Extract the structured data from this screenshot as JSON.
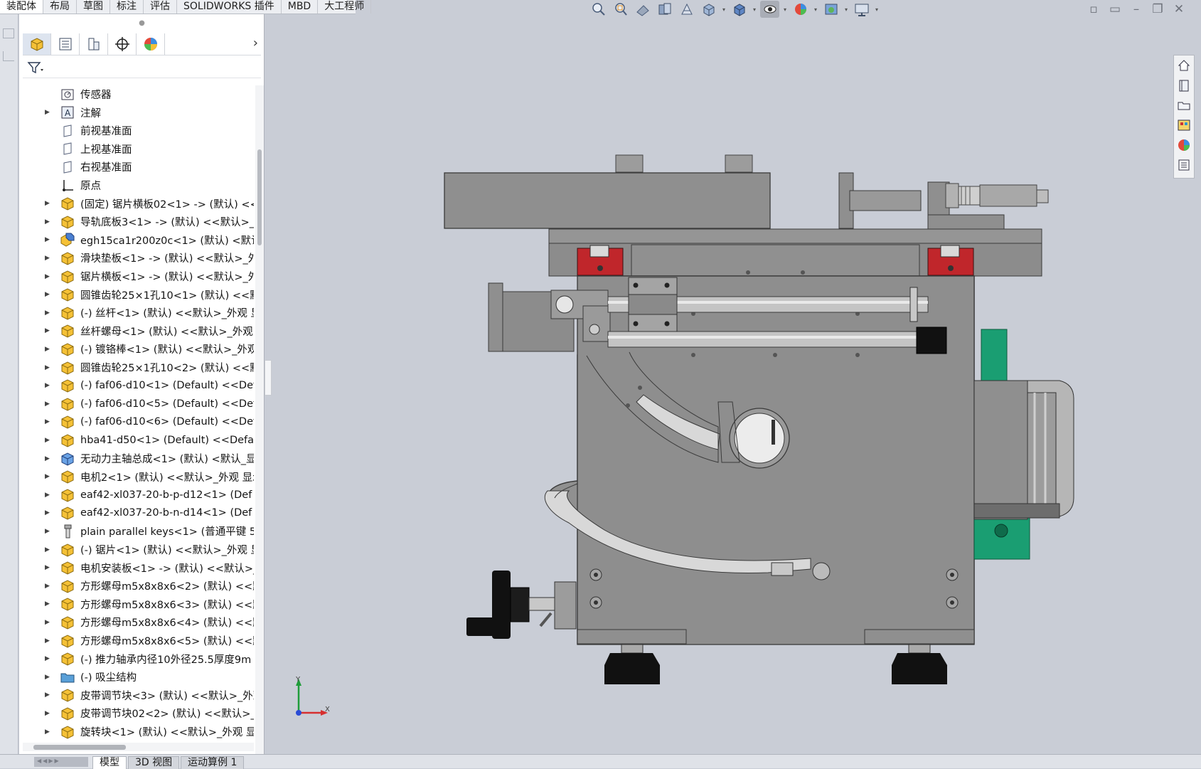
{
  "top_tabs": [
    "装配体",
    "布局",
    "草图",
    "标注",
    "评估",
    "SOLIDWORKS 插件",
    "MBD",
    "大工程师"
  ],
  "top_tabs_active": 0,
  "heads_up_toolbar": [
    "zoom-to-fit-icon",
    "zoom-to-area-icon",
    "previous-view-icon",
    "section-view-icon",
    "dynamic-annotation-icon",
    "view-orientation-icon",
    "display-style-icon",
    "hide-show-items-icon",
    "edit-appearance-icon",
    "apply-scene-icon",
    "view-settings-icon"
  ],
  "feature_manager": {
    "tool_icons": [
      "featuremanager-tree-icon",
      "property-manager-icon",
      "configuration-manager-icon",
      "dimxpert-icon",
      "display-manager-icon"
    ],
    "filter_icon": "filter-icon",
    "tree": [
      {
        "label": "传感器",
        "icon": "sensor-icon",
        "arrow": false
      },
      {
        "label": "注解",
        "icon": "annotation-icon",
        "arrow": true
      },
      {
        "label": "前视基准面",
        "icon": "plane-icon",
        "arrow": false
      },
      {
        "label": "上视基准面",
        "icon": "plane-icon",
        "arrow": false
      },
      {
        "label": "右视基准面",
        "icon": "plane-icon",
        "arrow": false
      },
      {
        "label": "原点",
        "icon": "origin-icon",
        "arrow": false
      },
      {
        "label": "(固定) 锯片横板02<1> -> (默认) <<",
        "icon": "part-icon",
        "arrow": true
      },
      {
        "label": "导轨底板3<1> -> (默认) <<默认>_外",
        "icon": "part-icon",
        "arrow": true
      },
      {
        "label": "egh15ca1r200z0c<1> (默认) <默认",
        "icon": "subassembly-icon",
        "arrow": true
      },
      {
        "label": "滑块垫板<1> -> (默认) <<默认>_外",
        "icon": "part-icon",
        "arrow": true
      },
      {
        "label": "锯片横板<1> -> (默认) <<默认>_外",
        "icon": "part-icon",
        "arrow": true
      },
      {
        "label": "圆锥齿轮25×1孔10<1> (默认) <<默",
        "icon": "part-icon",
        "arrow": true
      },
      {
        "label": "(-) 丝杆<1> (默认) <<默认>_外观 显",
        "icon": "part-icon",
        "arrow": true
      },
      {
        "label": "丝杆螺母<1> (默认) <<默认>_外观 显",
        "icon": "part-icon",
        "arrow": true
      },
      {
        "label": "(-) 镀铬棒<1> (默认) <<默认>_外观",
        "icon": "part-icon",
        "arrow": true
      },
      {
        "label": "圆锥齿轮25×1孔10<2> (默认) <<默",
        "icon": "part-icon",
        "arrow": true
      },
      {
        "label": "(-) faf06-d10<1> (Default) <<Defa",
        "icon": "part-icon",
        "arrow": true
      },
      {
        "label": "(-) faf06-d10<5> (Default) <<Defa",
        "icon": "part-icon",
        "arrow": true
      },
      {
        "label": "(-) faf06-d10<6> (Default) <<Defa",
        "icon": "part-icon",
        "arrow": true
      },
      {
        "label": "hba41-d50<1> (Default) <<Defau",
        "icon": "part-icon",
        "arrow": true
      },
      {
        "label": "无动力主轴总成<1> (默认) <默认_显",
        "icon": "subassembly-blue-icon",
        "arrow": true
      },
      {
        "label": "电机2<1> (默认) <<默认>_外观 显示",
        "icon": "part-icon",
        "arrow": true
      },
      {
        "label": "eaf42-xl037-20-b-p-d12<1> (Def",
        "icon": "part-icon",
        "arrow": true
      },
      {
        "label": "eaf42-xl037-20-b-n-d14<1> (Def",
        "icon": "part-icon",
        "arrow": true
      },
      {
        "label": "plain parallel keys<1> (普通平键 5)",
        "icon": "key-part-icon",
        "arrow": true
      },
      {
        "label": "(-) 锯片<1> (默认) <<默认>_外观 显",
        "icon": "part-icon",
        "arrow": true
      },
      {
        "label": "电机安装板<1> -> (默认) <<默认>_",
        "icon": "part-icon",
        "arrow": true
      },
      {
        "label": "方形螺母m5x8x8x6<2> (默认) <<默",
        "icon": "part-icon",
        "arrow": true
      },
      {
        "label": "方形螺母m5x8x8x6<3> (默认) <<默",
        "icon": "part-icon",
        "arrow": true
      },
      {
        "label": "方形螺母m5x8x8x6<4> (默认) <<默",
        "icon": "part-icon",
        "arrow": true
      },
      {
        "label": "方形螺母m5x8x8x6<5> (默认) <<默",
        "icon": "part-icon",
        "arrow": true
      },
      {
        "label": "(-) 推力轴承内径10外径25.5厚度9m",
        "icon": "part-icon",
        "arrow": true
      },
      {
        "label": "(-) 吸尘结构",
        "icon": "folder-icon",
        "arrow": true
      },
      {
        "label": "皮带调节块<3> (默认) <<默认>_外观",
        "icon": "part-icon",
        "arrow": true
      },
      {
        "label": "皮带调节块02<2> (默认) <<默认>_",
        "icon": "part-icon",
        "arrow": true
      },
      {
        "label": "旋转块<1> (默认) <<默认>_外观 显",
        "icon": "part-icon",
        "arrow": true
      }
    ]
  },
  "bottom_tabs": [
    "模型",
    "3D 视图",
    "运动算例 1"
  ],
  "bottom_tabs_active": 0,
  "task_pane": [
    "home-icon",
    "design-library-icon",
    "file-explorer-icon",
    "view-palette-icon",
    "appearances-icon",
    "custom-properties-icon"
  ],
  "triad": {
    "y": "Y",
    "x": "X"
  },
  "colors": {
    "viewport_bg": "#c9cdd6",
    "part_gray": "#8d8d8d",
    "red_block": "#c0262b",
    "green_block": "#1a9e72",
    "accent_blue": "#2a6fd6"
  }
}
